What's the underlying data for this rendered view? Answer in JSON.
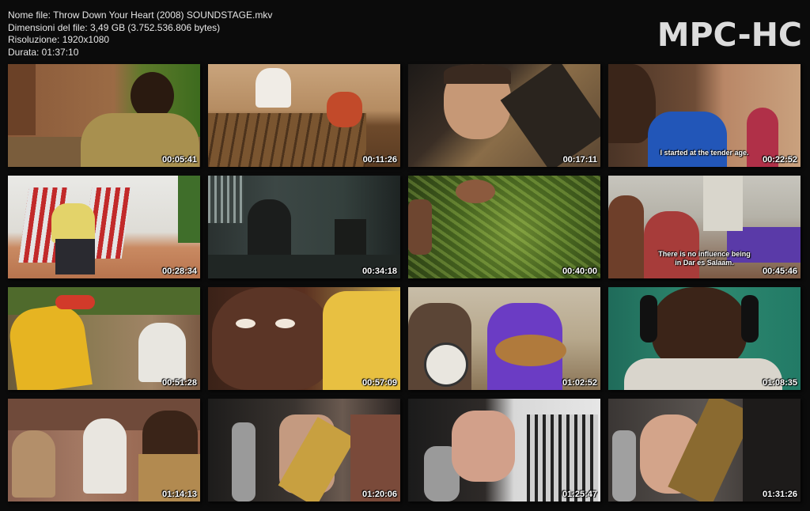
{
  "file_info": {
    "name_line": "Nome file: Throw Down Your Heart (2008) SOUNDSTAGE.mkv",
    "size_line": "Dimensioni del file: 3,49 GB (3.752.536.806 bytes)",
    "resolution_line": "Risoluzione: 1920x1080",
    "duration_line": "Durata: 01:37:10"
  },
  "logo": "MPC-HC",
  "thumbnails": [
    {
      "timestamp": "00:05:41",
      "subtitle": ""
    },
    {
      "timestamp": "00:11:26",
      "subtitle": ""
    },
    {
      "timestamp": "00:17:11",
      "subtitle": ""
    },
    {
      "timestamp": "00:22:52",
      "subtitle": "I started at the tender age."
    },
    {
      "timestamp": "00:28:34",
      "subtitle": ""
    },
    {
      "timestamp": "00:34:18",
      "subtitle": ""
    },
    {
      "timestamp": "00:40:00",
      "subtitle": ""
    },
    {
      "timestamp": "00:45:46",
      "subtitle": "There is no influence being\nin Dar es Salaam."
    },
    {
      "timestamp": "00:51:28",
      "subtitle": ""
    },
    {
      "timestamp": "00:57:09",
      "subtitle": ""
    },
    {
      "timestamp": "01:02:52",
      "subtitle": ""
    },
    {
      "timestamp": "01:08:35",
      "subtitle": ""
    },
    {
      "timestamp": "01:14:13",
      "subtitle": ""
    },
    {
      "timestamp": "01:20:06",
      "subtitle": ""
    },
    {
      "timestamp": "01:25:47",
      "subtitle": ""
    },
    {
      "timestamp": "01:31:26",
      "subtitle": ""
    }
  ]
}
